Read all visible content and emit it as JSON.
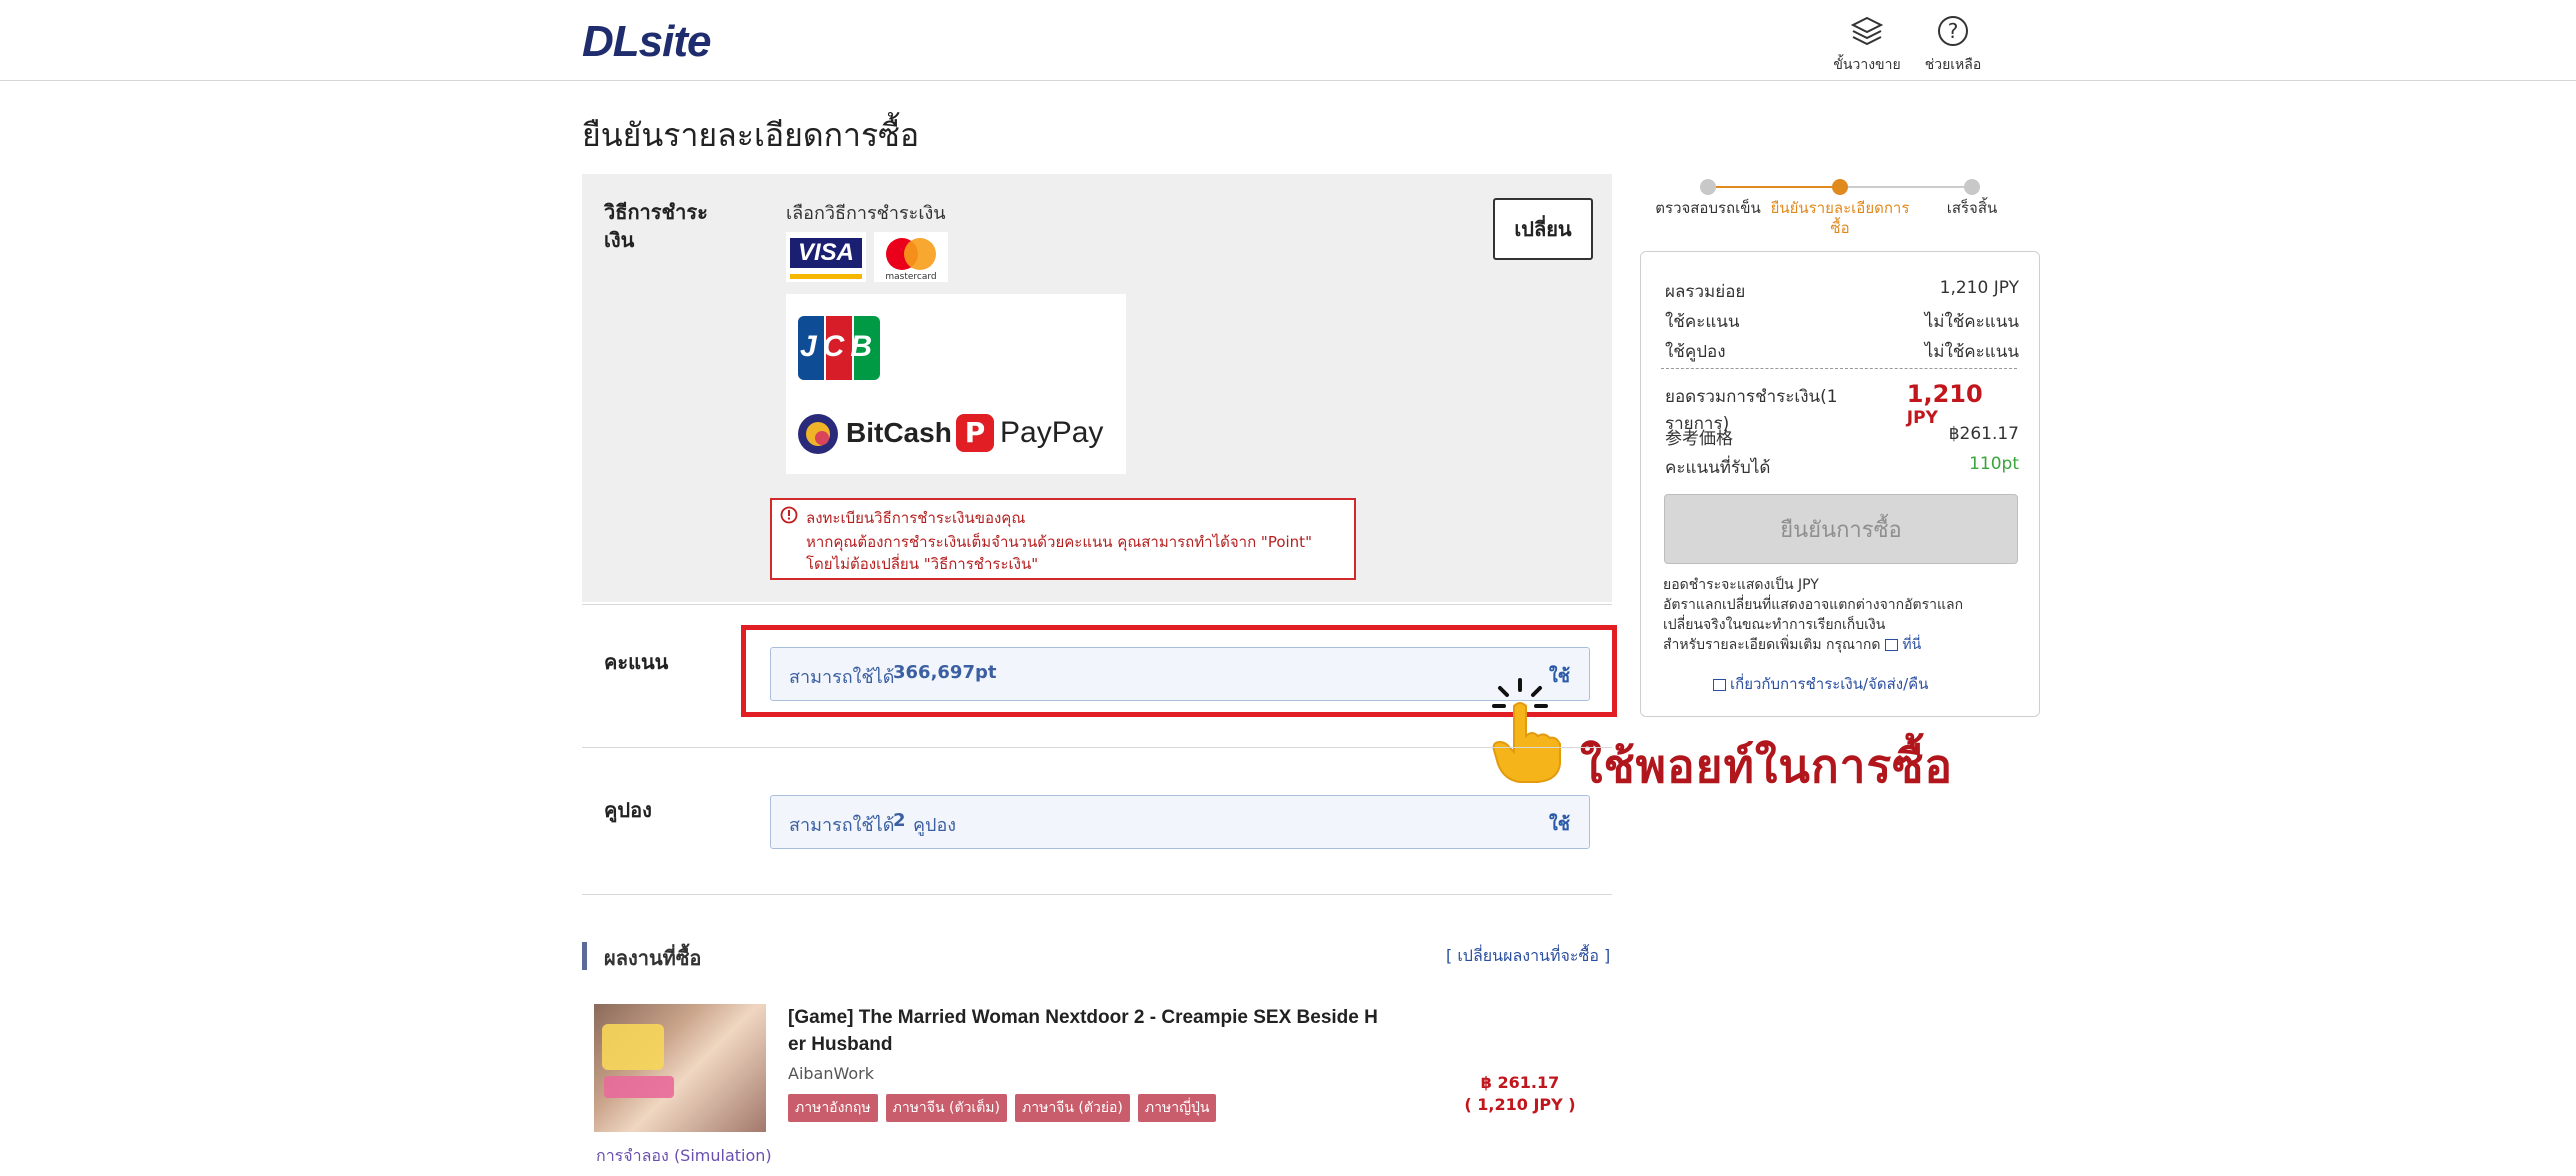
{
  "header": {
    "logo": "DLsite",
    "sell_label": "ขั้นวางขาย",
    "help_label": "ช่วยเหลือ"
  },
  "page_title": "ยืนยันรายละเอียดการซื้อ",
  "payment": {
    "section_label": "วิธีการชำระเงิน",
    "select_label": "เลือกวิธีการชำระเงิน",
    "change_button": "เปลี่ยน",
    "brands": [
      "VISA",
      "mastercard",
      "JCB",
      "BitCash",
      "PayPay"
    ],
    "warning_title": "ลงทะเบียนวิธีการชำระเงินของคุณ",
    "warning_line1": "หากคุณต้องการชำระเงินเต็มจำนวนด้วยคะแนน คุณสามารถทำได้จาก \"Point\"",
    "warning_line2": "โดยไม่ต้องเปลี่ยน \"วิธีการชำระเงิน\""
  },
  "points": {
    "section_label": "คะแนน",
    "available_prefix": "สามารถใช้ได้",
    "available_value": "366,697pt",
    "use_label": "ใช้"
  },
  "coupon": {
    "section_label": "คูปอง",
    "available_prefix": "สามารถใช้ได้",
    "available_value": "2",
    "available_suffix": "คูปอง",
    "use_label": "ใช้"
  },
  "callout": "ใช้พอยท์ในการซื้อ",
  "steps": [
    {
      "label": "ตรวจสอบรถเข็น",
      "state": "done"
    },
    {
      "label": "ยืนยันรายละเอียดการซื้อ",
      "state": "current"
    },
    {
      "label": "เสร็จสิ้น",
      "state": "todo"
    }
  ],
  "summary": {
    "subtotal_label": "ผลรวมย่อย",
    "subtotal_value": "1,210 JPY",
    "points_label": "ใช้คะแนน",
    "points_value": "ไม่ใช้คะแนน",
    "coupon_label": "ใช้คูปอง",
    "coupon_value": "ไม่ใช้คะแนน",
    "total_label": "ยอดรวมการชำระเงิน(1 รายการ)",
    "total_value": "1,210",
    "total_unit": "JPY",
    "ref_label": "参考価格",
    "ref_value": "฿261.17",
    "earn_label": "คะแนนที่รับได้",
    "earn_value": "110pt",
    "confirm_button": "ยืนยันการซื้อ",
    "note1": "ยอดชำระจะแสดงเป็น JPY",
    "note2": "อัตราแลกเปลี่ยนที่แสดงอาจแตกต่างจากอัตราแลก",
    "note3": "เปลี่ยนจริงในขณะทำการเรียกเก็บเงิน",
    "note4": "สำหรับรายละเอียดเพิ่มเติม กรุณากด",
    "note4_link": "ที่นี่",
    "policy_link": "เกี่ยวกับการชำระเงิน/จัดส่ง/คืน"
  },
  "works": {
    "section_label": "ผลงานที่ซื้อ",
    "change_link": "[ เปลี่ยนผลงานที่จะซื้อ ]",
    "item": {
      "title_line1": "[Game] The Married Woman Nextdoor 2 - Creampie SEX Beside H",
      "title_line2": "er Husband",
      "circle": "AibanWork",
      "tags": [
        "ภาษาอังกฤษ",
        "ภาษาจีน (ตัวเต็ม)",
        "ภาษาจีน (ตัวย่อ)",
        "ภาษาญี่ปุ่น"
      ],
      "price_thb": "฿ 261.17",
      "price_jpy": "( 1,210 JPY )",
      "simulation_link": "การจำลอง (Simulation)"
    }
  },
  "colors": {
    "accent_orange": "#e08a1e",
    "total_red": "#c0161c",
    "earn_green": "#3aa53a",
    "highlight_red": "#e01e24"
  }
}
